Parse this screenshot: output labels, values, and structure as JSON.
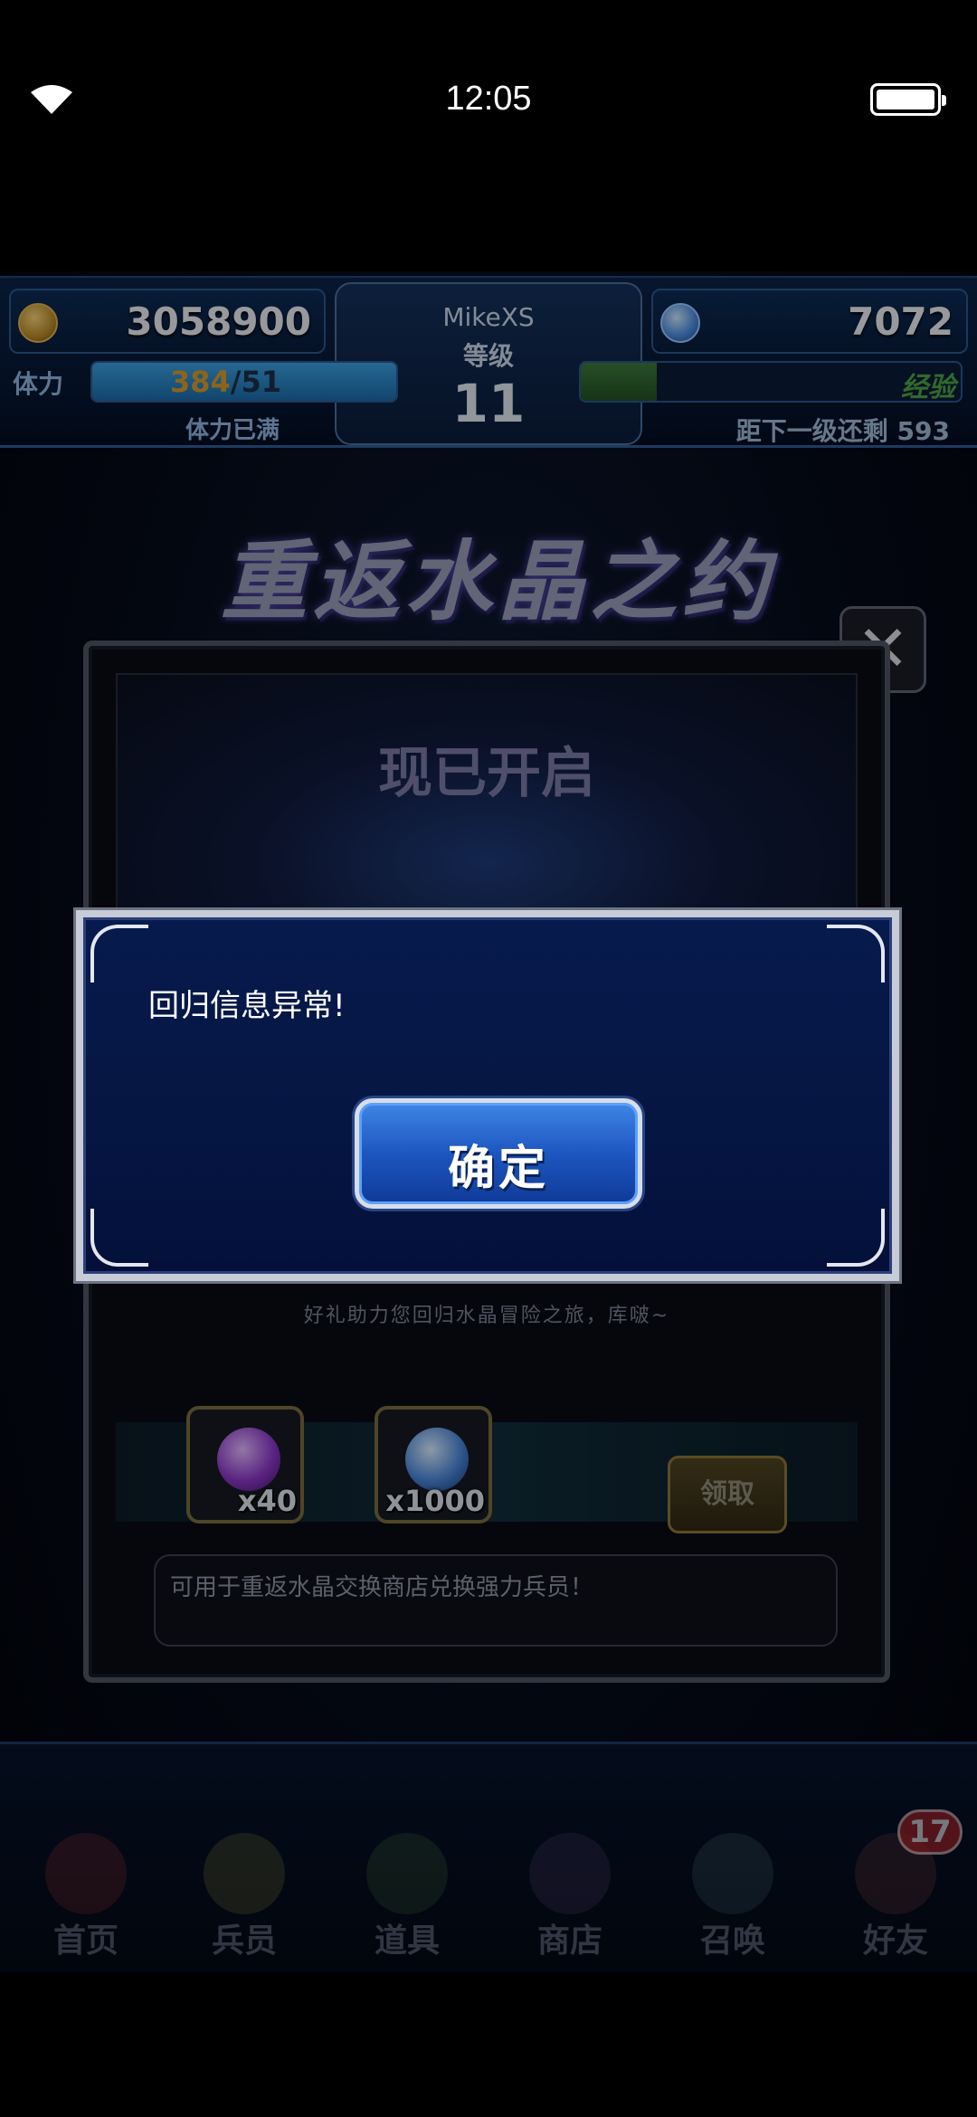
{
  "status_bar": {
    "time": "12:05",
    "wifi_icon": "wifi-icon",
    "battery_icon": "battery-full-icon"
  },
  "hud": {
    "gold": "3058900",
    "gems": "7072",
    "player_name": "MikeXS",
    "level_label": "等级",
    "level": "11",
    "stamina_label": "体力",
    "stamina_current": "384",
    "stamina_max": "/51",
    "stamina_status": "体力已满",
    "exp_label": "经验",
    "exp_remaining": "距下一级还剩 593"
  },
  "event": {
    "banner_title": "重返水晶之约",
    "opened_label": "现已开启",
    "description": "好礼助力您回归水晶冒险之旅，库啵~",
    "rewards": [
      {
        "icon": "s-ticket-icon",
        "quantity": "x40"
      },
      {
        "icon": "crystal-gem-icon",
        "quantity": "x1000"
      }
    ],
    "claim_label": "领取",
    "note": "可用于重返水晶交换商店兑换强力兵员！",
    "close_icon": "close-icon"
  },
  "modal": {
    "message": "回归信息异常!",
    "confirm_label": "确定"
  },
  "nav": {
    "items": [
      {
        "label": "首页",
        "icon": "home-icon"
      },
      {
        "label": "兵员",
        "icon": "unit-icon"
      },
      {
        "label": "道具",
        "icon": "item-icon"
      },
      {
        "label": "商店",
        "icon": "shop-icon"
      },
      {
        "label": "召唤",
        "icon": "summon-icon"
      },
      {
        "label": "好友",
        "icon": "friends-icon"
      }
    ],
    "friends_badge": "17"
  },
  "colors": {
    "modal_bg": "#051642",
    "button_blue": "#1d56c0",
    "stamina_fill": "#3aa0e0",
    "exp_fill": "#3d7a3b",
    "badge_red": "#b3282c"
  },
  "levels": {
    "stamina_fill_fraction": 1.0,
    "exp_fill_fraction": 0.2
  }
}
